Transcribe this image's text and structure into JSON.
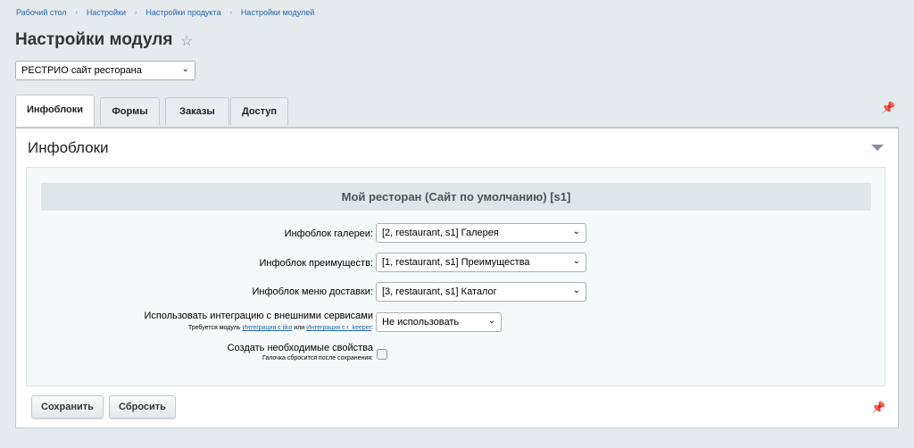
{
  "breadcrumb": [
    "Рабочий стол",
    "Настройки",
    "Настройки продукта",
    "Настройки модулей"
  ],
  "breadcrumb_separator": "›",
  "page_title": "Настройки модуля",
  "site_select": {
    "value": "РЕСТРИО сайт ресторана"
  },
  "tabs": [
    {
      "label": "Инфоблоки",
      "active": true
    },
    {
      "label": "Формы"
    },
    {
      "label": "Заказы"
    },
    {
      "label": "Доступ"
    }
  ],
  "panel": {
    "title": "Инфоблоки",
    "section_header": "Мой ресторан (Сайт по умолчанию) [s1]",
    "fields": {
      "gallery": {
        "label": "Инфоблок галереи:",
        "value": "[2, restaurant, s1] Галерея"
      },
      "advantages": {
        "label": "Инфоблок преимуществ:",
        "value": "[1, restaurant, s1] Преимущества"
      },
      "delivery": {
        "label": "Инфоблок меню доставки:",
        "value": "[3, restaurant, s1] Каталог"
      },
      "integration": {
        "label": "Использовать интеграцию с внешними сервисами",
        "hint_prefix": "Требуется модуль",
        "link_iiko": "Интеграция с iiko",
        "hint_or": "или",
        "link_keeper": "Интеграция с r_keeper",
        "hint_suffix": ":",
        "value": "Не использовать"
      },
      "create_props": {
        "label": "Создать необходимые свойства",
        "hint": "Галочка сбросится после сохранения:",
        "checked": false
      }
    }
  },
  "buttons": {
    "save": "Сохранить",
    "reset": "Сбросить"
  },
  "icons": {
    "star": "star-icon",
    "pin": "pin-icon",
    "collapse": "triangle-down-icon",
    "select": "chevron-down-icon"
  }
}
